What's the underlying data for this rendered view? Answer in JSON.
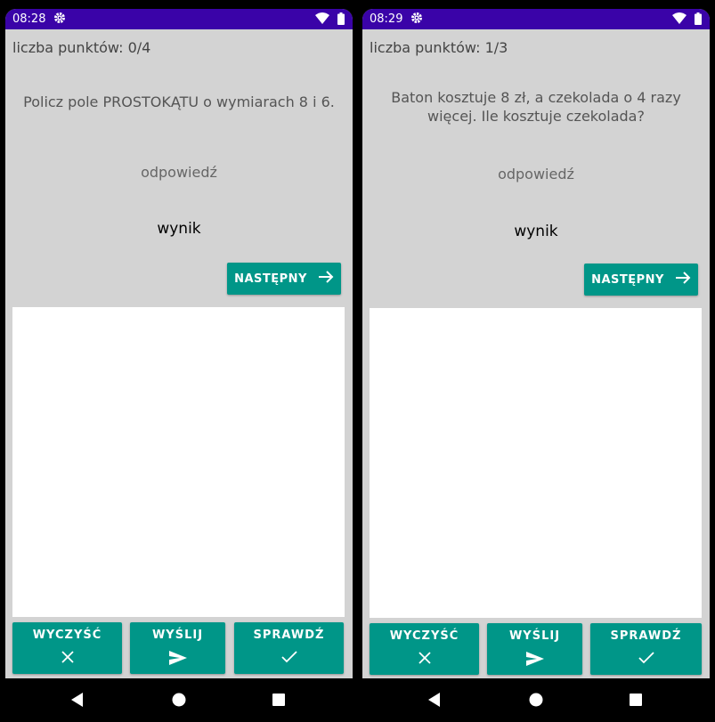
{
  "screens": [
    {
      "status": {
        "time": "08:28"
      },
      "score": "liczba punktów: 0/4",
      "question": "Policz pole PROSTOKĄTU o wymiarach 8 i 6.",
      "answer_placeholder": "odpowiedź",
      "result": "wynik",
      "next_label": "NASTĘPNY",
      "buttons": {
        "clear": "WYCZYŚĆ",
        "send": "WYŚLIJ",
        "check": "SPRAWDŹ"
      }
    },
    {
      "status": {
        "time": "08:29"
      },
      "score": "liczba punktów: 1/3",
      "question": "Baton kosztuje 8 zł, a czekolada o 4 razy więcej. Ile kosztuje czekolada?",
      "answer_placeholder": "odpowiedź",
      "result": "wynik",
      "next_label": "NASTĘPNY",
      "buttons": {
        "clear": "WYCZYŚĆ",
        "send": "WYŚLIJ",
        "check": "SPRAWDŹ"
      }
    }
  ],
  "icons": {
    "settings": "gear-icon",
    "wifi": "wifi-icon",
    "battery": "battery-icon",
    "next": "arrow-right-icon",
    "clear": "close-icon",
    "send": "send-icon",
    "check": "check-icon",
    "back": "back-icon",
    "home": "home-icon",
    "recents": "recents-icon"
  },
  "colors": {
    "accent": "#009688",
    "status_bar": "#3a03a8",
    "background": "#d3d3d3",
    "canvas": "#ffffff"
  }
}
